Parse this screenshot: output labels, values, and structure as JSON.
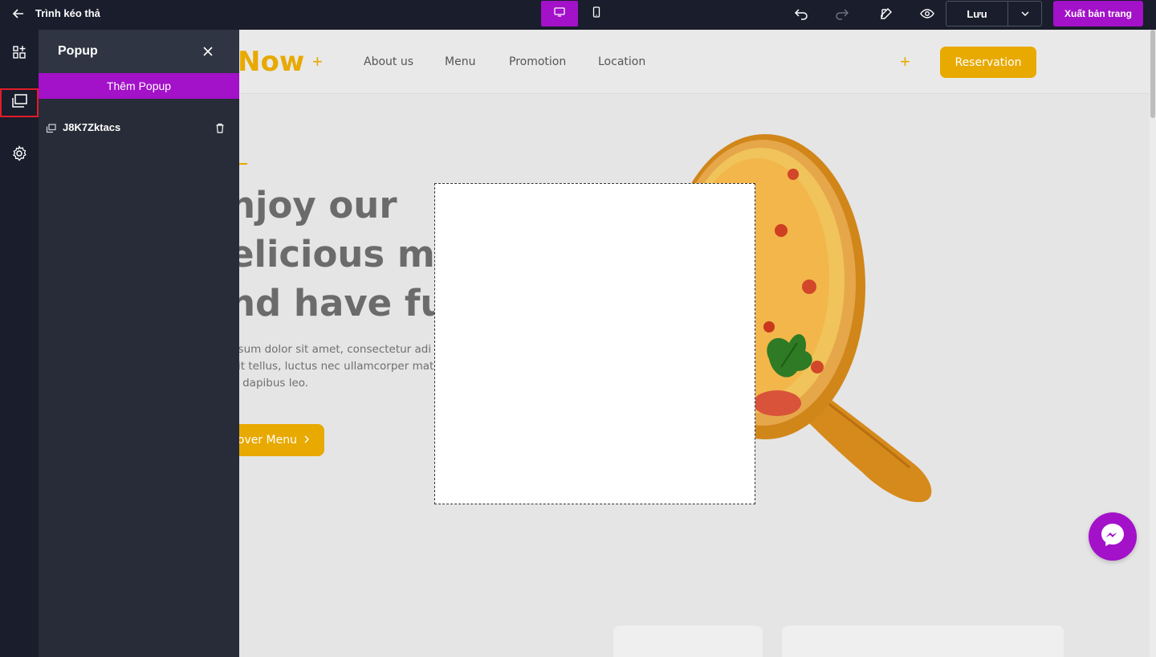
{
  "app": {
    "title": "Trình kéo thả"
  },
  "toolbar": {
    "save_label": "Lưu",
    "publish_label": "Xuất bản trang",
    "icons": [
      "back-arrow-icon",
      "desktop-icon",
      "mobile-icon",
      "undo-icon",
      "redo-icon",
      "edit-icon",
      "eye-icon",
      "chevron-down-icon"
    ]
  },
  "rail": {
    "items": [
      "elements-icon",
      "popup-icon",
      "settings-icon"
    ]
  },
  "panel": {
    "title": "Popup",
    "add_label": "Thêm Popup",
    "items": [
      {
        "name": "J8K7Zktacs"
      }
    ]
  },
  "site": {
    "logo": "Now",
    "nav": [
      "About us",
      "Menu",
      "Promotion",
      "Location"
    ],
    "reserve_label": "Reservation",
    "hero_lines": [
      "njoy our",
      "elicious me",
      "nd have fun"
    ],
    "hero_paragraph": [
      "Ipsum dolor sit amet, consectetur adi",
      "elit tellus, luctus nec ullamcorper mat",
      "ar dapibus leo."
    ],
    "discover_label": "over Menu",
    "discover_icon": "chevron-right-icon"
  },
  "colors": {
    "accent": "#a311c9",
    "brand": "#e8a900",
    "dark": "#1a1d2b",
    "panel": "#272c38"
  }
}
